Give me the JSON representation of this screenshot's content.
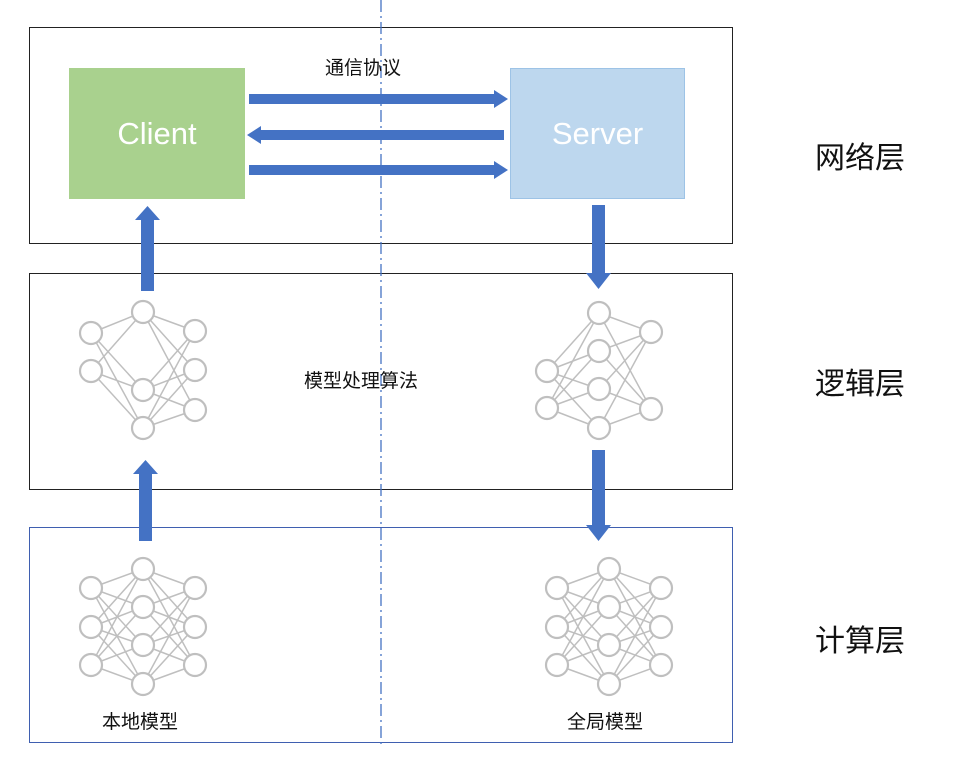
{
  "layers": {
    "network": "网络层",
    "logic": "逻辑层",
    "compute": "计算层"
  },
  "nodes": {
    "client": "Client",
    "server": "Server"
  },
  "labels": {
    "protocol": "通信协议",
    "algorithm": "模型处理算法",
    "local_model": "本地模型",
    "global_model": "全局模型"
  },
  "colors": {
    "client_fill": "#a9d18e",
    "server_fill": "#bdd7ee",
    "arrow": "#4472c4",
    "network_node": "#bfbfbf",
    "divider": "#4472c4"
  },
  "icons": {
    "network": "neural-network-icon",
    "arrow": "arrow-icon"
  }
}
